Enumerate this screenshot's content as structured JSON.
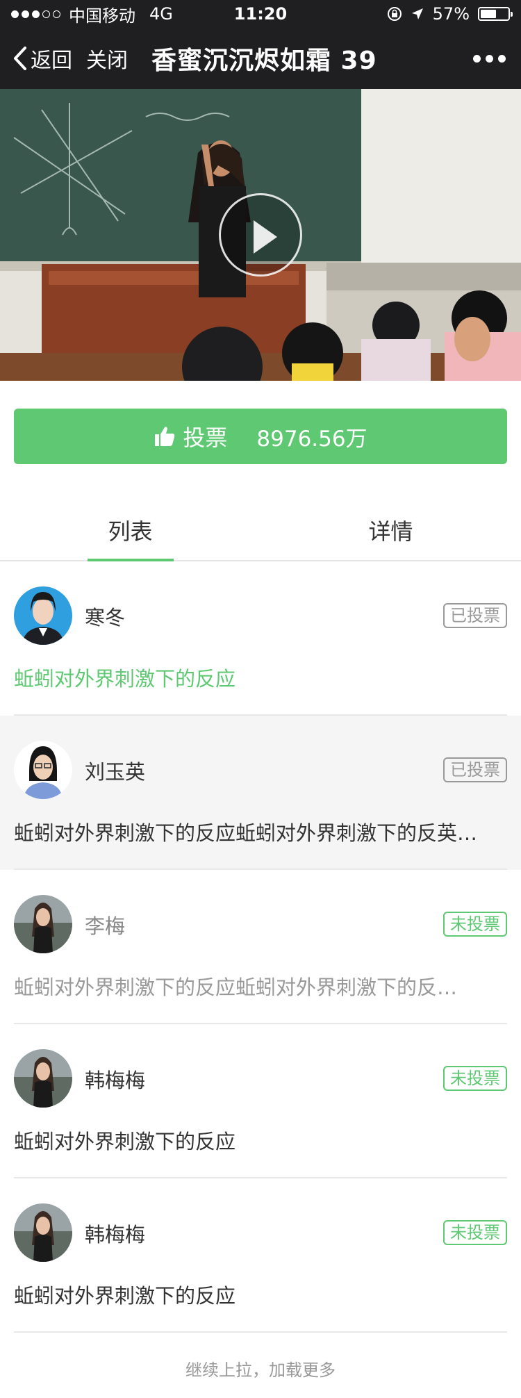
{
  "status_bar": {
    "carrier": "中国移动",
    "network": "4G",
    "time": "11:20",
    "battery": "57%",
    "battery_level": 0.57,
    "signal_dots_filled": 3,
    "signal_dots_total": 5
  },
  "nav": {
    "back_label": "返回",
    "close_label": "关闭",
    "title": "香蜜沉沉烬如霜 39",
    "more_icon": "ellipsis-icon"
  },
  "vote": {
    "label": "投票",
    "count": "8976.56万",
    "icon": "thumbs-up-icon"
  },
  "tabs": [
    {
      "label": "列表",
      "active": true
    },
    {
      "label": "详情",
      "active": false
    }
  ],
  "items": [
    {
      "name": "寒冬",
      "badge": "已投票",
      "desc": "蚯蚓对外界刺激下的反应"
    },
    {
      "name": "刘玉英",
      "badge": "已投票",
      "desc": "蚯蚓对外界刺激下的反应蚯蚓对外界刺激下的反英…"
    },
    {
      "name": "李梅",
      "badge": "未投票",
      "desc": "蚯蚓对外界刺激下的反应蚯蚓对外界刺激下的反…"
    },
    {
      "name": "韩梅梅",
      "badge": "未投票",
      "desc": "蚯蚓对外界刺激下的反应"
    },
    {
      "name": "韩梅梅",
      "badge": "未投票",
      "desc": "蚯蚓对外界刺激下的反应"
    }
  ],
  "load_more": "继续上拉，加载更多",
  "colors": {
    "accent": "#5ec872",
    "topbar": "#1f1f22",
    "voted_badge": "#999999"
  }
}
